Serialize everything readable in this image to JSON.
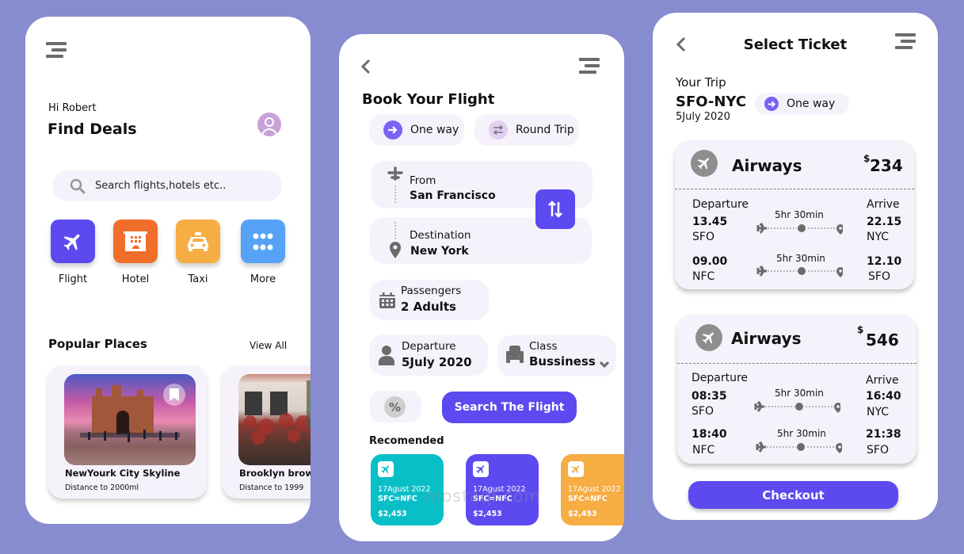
{
  "home": {
    "greeting": "Hi Robert",
    "title": "Find Deals",
    "search_placeholder": "Search flights,hotels etc..",
    "categories": [
      {
        "label": "Flight",
        "icon": "plane-icon",
        "color": "#5c4af0"
      },
      {
        "label": "Hotel",
        "icon": "hotel-icon",
        "color": "#f06e2a"
      },
      {
        "label": "Taxi",
        "icon": "taxi-icon",
        "color": "#f5ad44"
      },
      {
        "label": "More",
        "icon": "more-dots-icon",
        "color": "#56a2f7"
      }
    ],
    "popular_title": "Popular Places",
    "view_all": "View All",
    "places": [
      {
        "name": "NewYourk City Skyline",
        "distance": "Distance to 2000ml"
      },
      {
        "name": "Brooklyn brow",
        "distance": "Distance to 1999"
      }
    ]
  },
  "booking": {
    "title": "Book Your Flight",
    "trip_types": [
      {
        "label": "One way",
        "selected": true
      },
      {
        "label": "Round Trip",
        "selected": false
      }
    ],
    "from_label": "From",
    "from_value": "San Francisco",
    "destination_label": "Destination",
    "destination_value": "New York",
    "passengers_label": "Passengers",
    "passengers_value": "2 Adults",
    "departure_label": "Departure",
    "departure_value": "5July 2020",
    "class_label": "Class",
    "class_value": "Bussiness",
    "discount_symbol": "%",
    "search_button": "Search The Flight",
    "recommended_title": "Recomended",
    "recommended": [
      {
        "date": "17Agust 2022",
        "route": "SFC=NFC",
        "price": "$2,453",
        "color": "#08bfc8"
      },
      {
        "date": "17Agust 2022",
        "route": "SFC=NFC",
        "price": "$2,453",
        "color": "#5c4af0"
      },
      {
        "date": "17Agust 2022",
        "route": "SFC=NFC",
        "price": "$2,453",
        "color": "#f5ad44"
      }
    ]
  },
  "tickets": {
    "title": "Select Ticket",
    "trip_label": "Your Trip",
    "route": "SFO-NYC",
    "trip_type": "One way",
    "date": "5July 2020",
    "list": [
      {
        "airline": "Airways",
        "currency": "$",
        "price": "234",
        "departure_label": "Departure",
        "arrive_label": "Arrive",
        "legs": [
          {
            "dep_time": "13.45",
            "dep_code": "SFO",
            "duration": "5hr 30min",
            "arr_time": "22.15",
            "arr_code": "NYC"
          },
          {
            "dep_time": "09.00",
            "dep_code": "NFC",
            "duration": "5hr 30min",
            "arr_time": "12.10",
            "arr_code": "SFO"
          }
        ]
      },
      {
        "airline": "Airways",
        "currency": "$",
        "price": "546",
        "departure_label": "Departure",
        "arrive_label": "Arrive",
        "legs": [
          {
            "dep_time": "08:35",
            "dep_code": "SFO",
            "duration": "5hr 30min",
            "arr_time": "16:40",
            "arr_code": "NYC"
          },
          {
            "dep_time": "18:40",
            "dep_code": "NFC",
            "duration": "5hr 30min",
            "arr_time": "21:38",
            "arr_code": "SFO"
          }
        ]
      }
    ],
    "checkout_button": "Checkout"
  },
  "watermark": "mostaql.com",
  "colors": {
    "accent": "#5c4af0",
    "background": "#878bcf",
    "field": "#f6f2fb",
    "icon_gray": "#6b6b6b"
  }
}
